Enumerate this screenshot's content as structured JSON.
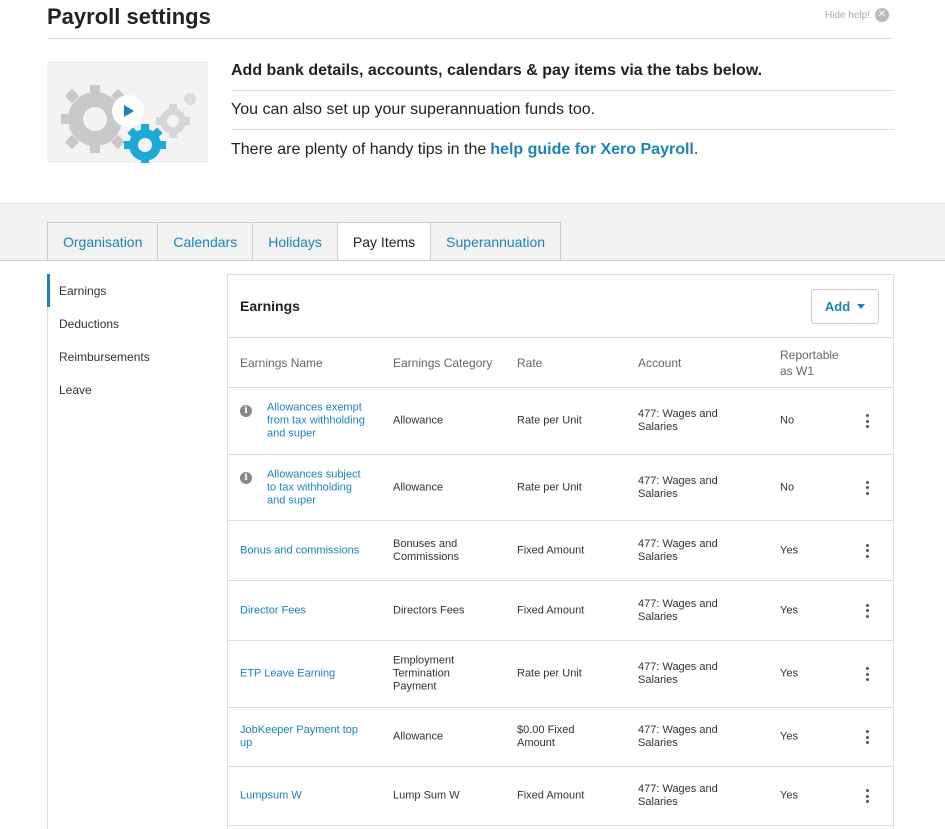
{
  "page": {
    "title": "Payroll settings",
    "hide_help": "Hide help!",
    "hide_help_icon": "close-circle-icon"
  },
  "help": {
    "line1": "Add bank details, accounts, calendars & pay items via the tabs below.",
    "line2": "You can also set up your superannuation funds too.",
    "line3_prefix": "There are plenty of handy tips in the",
    "line3_link": "help guide for Xero Payroll",
    "line3_suffix": ".",
    "image_icon": "gears-play-icon"
  },
  "tabs": [
    {
      "label": "Organisation"
    },
    {
      "label": "Calendars"
    },
    {
      "label": "Holidays"
    },
    {
      "label": "Pay Items",
      "active": true
    },
    {
      "label": "Superannuation"
    }
  ],
  "sidenav": [
    {
      "label": "Earnings",
      "active": true
    },
    {
      "label": "Deductions"
    },
    {
      "label": "Reimbursements"
    },
    {
      "label": "Leave"
    }
  ],
  "panel": {
    "title": "Earnings",
    "add_label": "Add"
  },
  "columns": {
    "name": "Earnings Name",
    "category": "Earnings Category",
    "rate": "Rate",
    "account": "Account",
    "reportable_1": "Reportable",
    "reportable_2": "as W1"
  },
  "rows": [
    {
      "name": [
        "Allowances exempt",
        "from tax withholding",
        "and super"
      ],
      "info": true,
      "category": [
        "Allowance"
      ],
      "rate": [
        "Rate per Unit"
      ],
      "account": [
        "477: Wages and",
        "Salaries"
      ],
      "w1": "No"
    },
    {
      "name": [
        "Allowances subject",
        "to tax withholding",
        "and super"
      ],
      "info": true,
      "category": [
        "Allowance"
      ],
      "rate": [
        "Rate per Unit"
      ],
      "account": [
        "477: Wages and",
        "Salaries"
      ],
      "w1": "No"
    },
    {
      "name": [
        "Bonus and commissions"
      ],
      "category": [
        "Bonuses and",
        "Commissions"
      ],
      "rate": [
        "Fixed Amount"
      ],
      "account": [
        "477: Wages and",
        "Salaries"
      ],
      "w1": "Yes"
    },
    {
      "name": [
        "Director Fees"
      ],
      "category": [
        "Directors Fees"
      ],
      "rate": [
        "Fixed Amount"
      ],
      "account": [
        "477: Wages and",
        "Salaries"
      ],
      "w1": "Yes"
    },
    {
      "name": [
        "ETP Leave Earning"
      ],
      "category": [
        "Employment",
        "Termination",
        "Payment"
      ],
      "rate": [
        "Rate per Unit"
      ],
      "account": [
        "477: Wages and",
        "Salaries"
      ],
      "w1": "Yes"
    },
    {
      "name": [
        "JobKeeper Payment top",
        "up"
      ],
      "category": [
        "Allowance"
      ],
      "rate": [
        "$0.00 Fixed",
        "Amount"
      ],
      "account": [
        "477: Wages and",
        "Salaries"
      ],
      "w1": "Yes"
    },
    {
      "name": [
        "Lumpsum W"
      ],
      "category": [
        "Lump Sum W"
      ],
      "rate": [
        "Fixed Amount"
      ],
      "account": [
        "477: Wages and",
        "Salaries"
      ],
      "w1": "Yes"
    }
  ]
}
